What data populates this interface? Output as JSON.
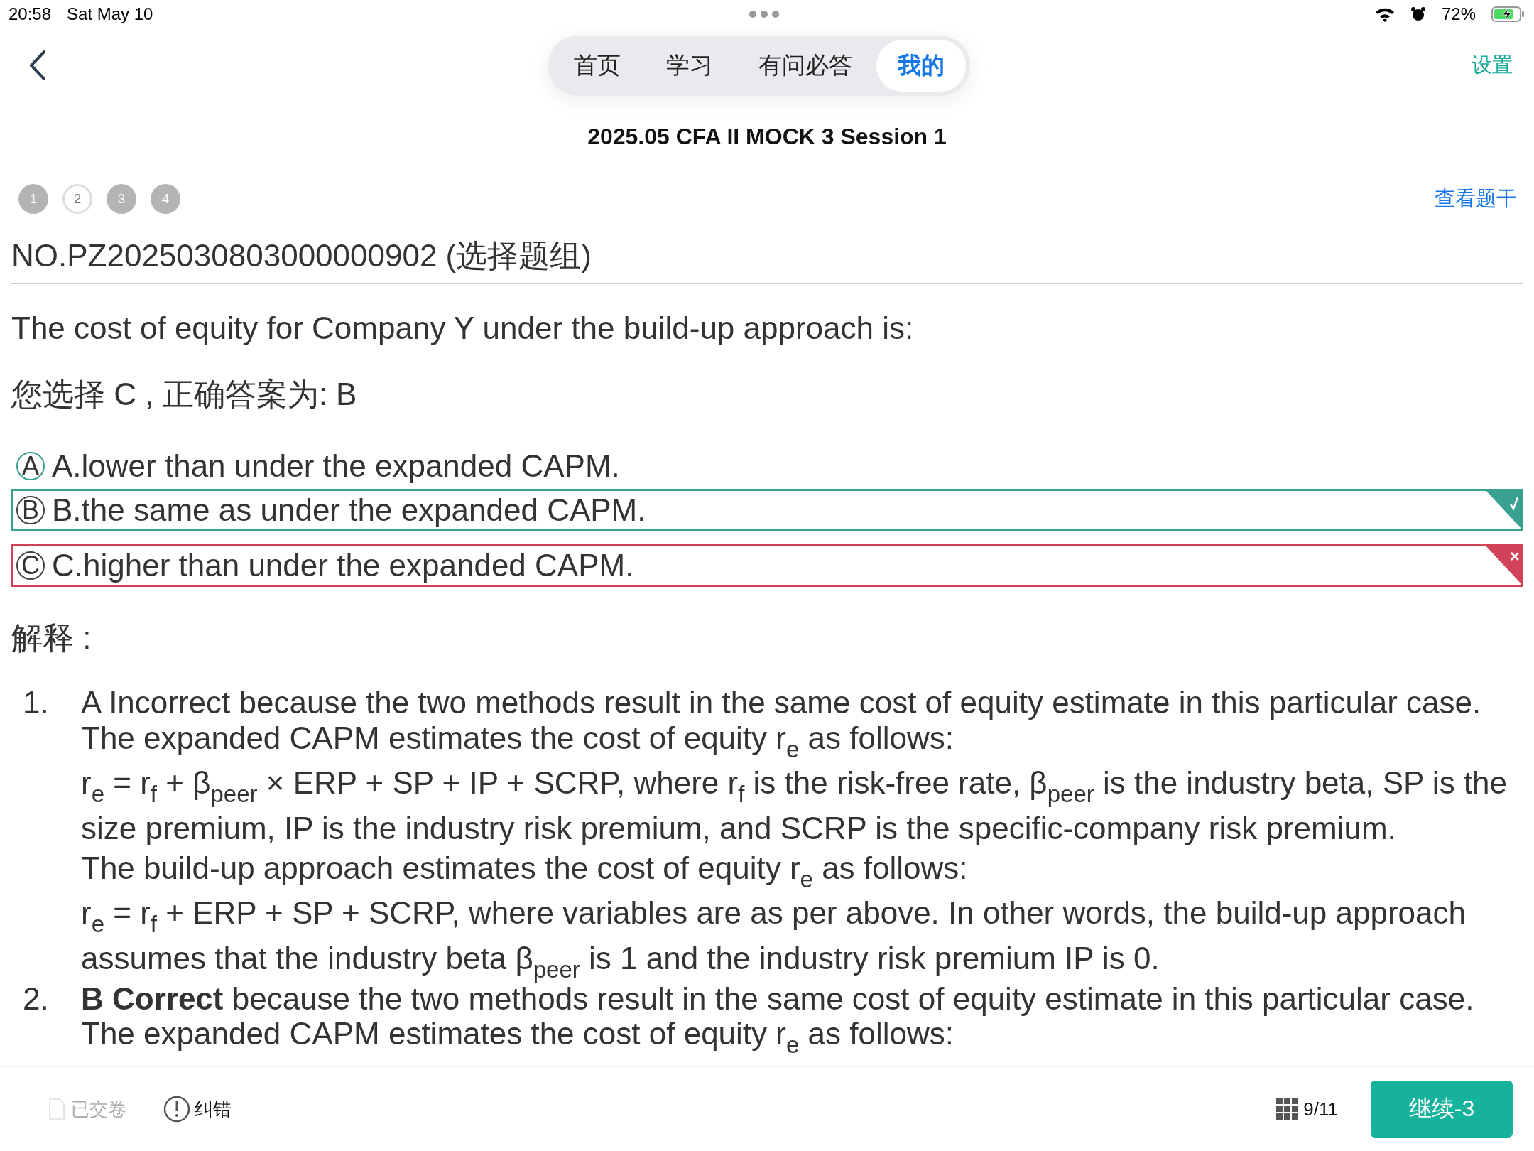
{
  "status_bar": {
    "time": "20:58",
    "date": "Sat May 10",
    "battery": "72%"
  },
  "nav": {
    "tabs": [
      {
        "label": "首页",
        "selected": false
      },
      {
        "label": "学习",
        "selected": false
      },
      {
        "label": "有问必答",
        "selected": false
      },
      {
        "label": "我的",
        "selected": true
      }
    ],
    "settings": "设置"
  },
  "title": "2025.05 CFA II MOCK 3 Session 1",
  "question_dots": [
    {
      "label": "1",
      "selected": false
    },
    {
      "label": "2",
      "selected": true
    },
    {
      "label": "3",
      "selected": false
    },
    {
      "label": "4",
      "selected": false
    }
  ],
  "view_stem": "查看题干",
  "question_no": "NO.PZ2025030803000000902 (选择题组)",
  "question": "The cost of equity for Company Y under the build-up approach is:",
  "answer_line": "您选择 C , 正确答案为: B",
  "options": [
    {
      "letter": "A",
      "text": "A.lower than under the expanded CAPM.",
      "kind": "plain"
    },
    {
      "letter": "B",
      "text": "B.the same as under the expanded CAPM.",
      "kind": "correct"
    },
    {
      "letter": "C",
      "text": "C.higher than under the expanded CAPM.",
      "kind": "wrong"
    }
  ],
  "explanation_label": "解释 :",
  "explanation": [
    {
      "number": "1.",
      "paragraphs": [
        {
          "kind": "text",
          "text": "A Incorrect because the two methods result in the same cost of equity estimate in this particular case."
        },
        {
          "kind": "text",
          "text": "The expanded CAPM estimates the cost of equity r$_{e}$ as follows:"
        },
        {
          "kind": "formula",
          "text": "r$_{e}$ = r$_{f}$ + β$_{peer}$ × ERP + SP + IP + SCRP, where r$_{f}$ is the risk-free rate, β$_{peer}$ is the industry beta, SP is the size premium, IP is the industry risk premium, and SCRP is the specific-company risk premium."
        },
        {
          "kind": "text",
          "text": "The build-up approach estimates the cost of equity r$_{e}$ as follows:"
        },
        {
          "kind": "formula",
          "text": "r$_{e}$ = r$_{f}$ + ERP + SP + SCRP, where variables are as per above. In other words, the build-up approach assumes that the industry beta β$_{peer}$ is 1 and the industry risk premium IP is 0."
        }
      ]
    },
    {
      "number": "2.",
      "paragraphs": [
        {
          "kind": "text",
          "text": "**B Correct** because the two methods result in the same cost of equity estimate in this particular case."
        },
        {
          "kind": "text",
          "text": "The expanded CAPM estimates the cost of equity r$_{e}$ as follows:"
        }
      ]
    }
  ],
  "bottom_bar": {
    "submitted": "已交卷",
    "report_error": "纠错",
    "progress": "9/11",
    "continue": "继续-3"
  }
}
